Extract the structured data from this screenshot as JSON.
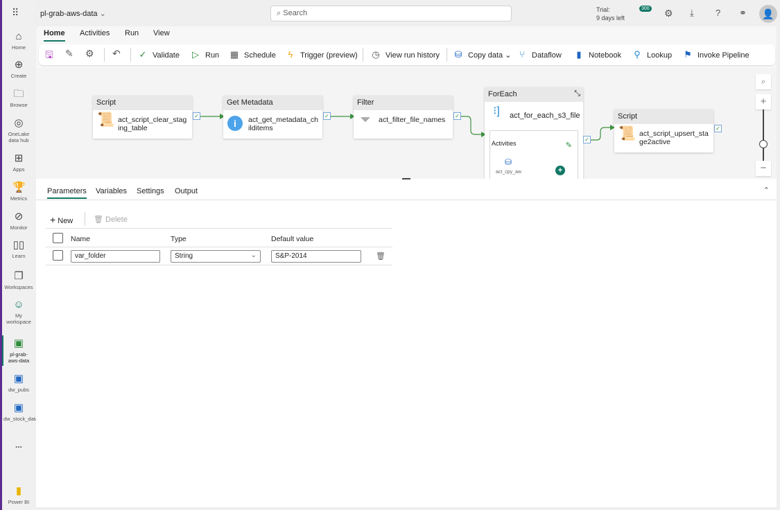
{
  "app": {
    "title": "pl-grab-aws-data",
    "search_placeholder": "Search",
    "trial_label": "Trial:",
    "trial_days": "9 days left",
    "notification_count": "300"
  },
  "rail": [
    {
      "label": "Home",
      "icon": "home-icon"
    },
    {
      "label": "Create",
      "icon": "create-icon"
    },
    {
      "label": "Browse",
      "icon": "browse-icon"
    },
    {
      "label": "OneLake data hub",
      "icon": "onelake-icon"
    },
    {
      "label": "Apps",
      "icon": "apps-icon"
    },
    {
      "label": "Metrics",
      "icon": "metrics-icon"
    },
    {
      "label": "Monitor",
      "icon": "monitor-icon"
    },
    {
      "label": "Learn",
      "icon": "learn-icon"
    },
    {
      "label": "Workspaces",
      "icon": "workspaces-icon"
    },
    {
      "label": "My workspace",
      "icon": "my-workspace-icon"
    },
    {
      "label": "pl-grab-aws-data",
      "icon": "pipeline-icon"
    },
    {
      "label": "dw_pubs",
      "icon": "warehouse-icon"
    },
    {
      "label": "dw_stock_data",
      "icon": "warehouse-icon"
    },
    {
      "label": "...",
      "icon": "more-icon"
    },
    {
      "label": "Power BI",
      "icon": "powerbi-icon"
    }
  ],
  "ribbon_tabs": [
    "Home",
    "Activities",
    "Run",
    "View"
  ],
  "toolbar": {
    "validate": "Validate",
    "run": "Run",
    "schedule": "Schedule",
    "trigger": "Trigger (preview)",
    "history": "View run history",
    "copy": "Copy data",
    "dataflow": "Dataflow",
    "notebook": "Notebook",
    "lookup": "Lookup",
    "invoke": "Invoke Pipeline"
  },
  "nodes": [
    {
      "type": "Script",
      "name": "act_script_clear_staging_table"
    },
    {
      "type": "Get Metadata",
      "name": "act_get_metadata_childitems"
    },
    {
      "type": "Filter",
      "name": "act_filter_file_names"
    },
    {
      "type": "ForEach",
      "name": "act_for_each_s3_file",
      "activities_label": "Activities",
      "inner": "act_cpy_aw"
    },
    {
      "type": "Script",
      "name": "act_script_upsert_stage2active"
    }
  ],
  "panel": {
    "tabs": [
      "Parameters",
      "Variables",
      "Settings",
      "Output"
    ],
    "new": "New",
    "delete": "Delete",
    "columns": [
      "Name",
      "Type",
      "Default value"
    ],
    "rows": [
      {
        "name": "var_folder",
        "type": "String",
        "default": "S&P-2014"
      }
    ]
  }
}
